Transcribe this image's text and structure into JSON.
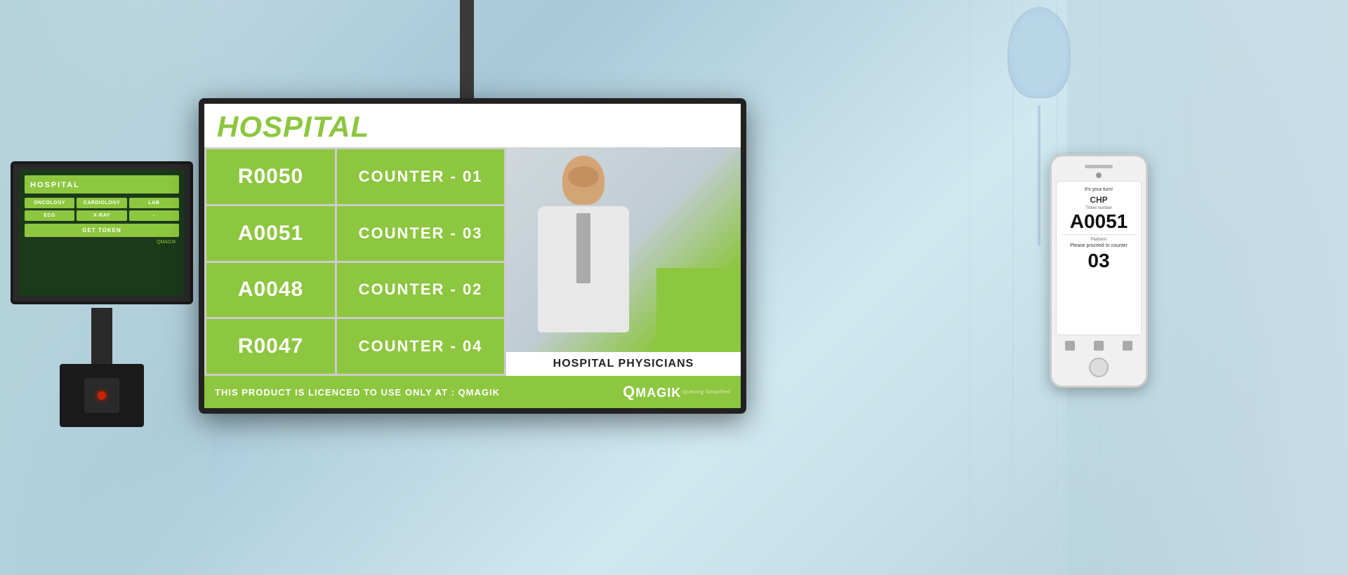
{
  "scene": {
    "background": "#b8d4dc"
  },
  "tv": {
    "title": "HOSPITAL",
    "rows": [
      {
        "ticket": "R0050",
        "counter": "COUNTER - 01"
      },
      {
        "ticket": "A0051",
        "counter": "COUNTER - 03"
      },
      {
        "ticket": "A0048",
        "counter": "COUNTER - 02"
      },
      {
        "ticket": "R0047",
        "counter": "COUNTER - 04"
      }
    ],
    "physician_label": "HOSPITAL PHYSICIANS",
    "footer_text": "THIS PRODUCT IS LICENCED TO USE ONLY AT :  QMAGIK",
    "logo": "QMAGIK",
    "logo_tagline": "Queuing Simplified"
  },
  "kiosk": {
    "title": "HOSPITAL",
    "buttons_row1": [
      "ONCOLOGY",
      "CARDIOLOGY",
      "LAB"
    ],
    "buttons_row2": [
      "ECG",
      "X-RAY",
      "-"
    ],
    "get_token_label": "GET TOKEN",
    "brand": "QMAGIK"
  },
  "phone": {
    "turn_text": "It's your turn!",
    "org": "CHP",
    "ticket_label": "Ticket number",
    "ticket_number": "A0051",
    "platform_label": "Platform",
    "counter_text": "Please proceed to counter",
    "counter_number": "03"
  }
}
